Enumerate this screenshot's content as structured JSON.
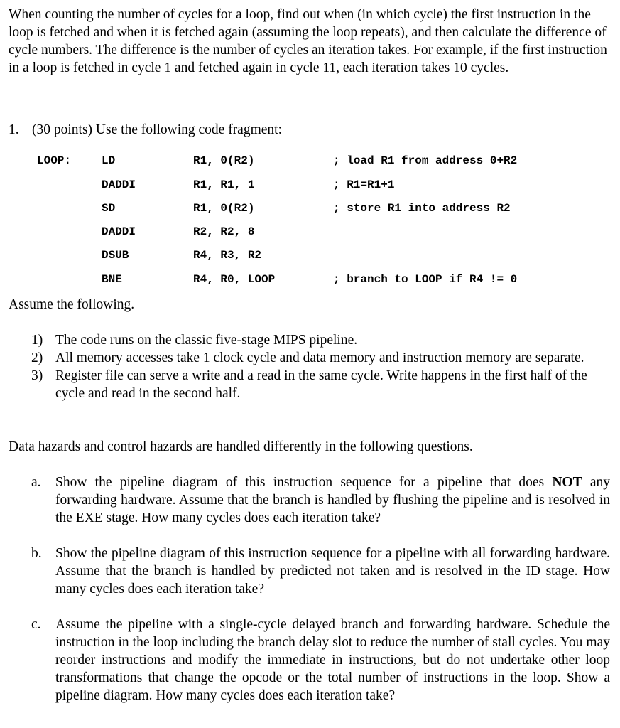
{
  "intro": "When counting the number of cycles for a loop, find out when (in which cycle) the first instruction in the loop is fetched and when it is fetched again (assuming the loop repeats), and then calculate the difference of cycle numbers. The difference is the number of cycles an iteration takes. For example, if the first instruction in a loop is fetched in cycle 1 and fetched again in cycle 11, each iteration takes 10 cycles.",
  "question": {
    "number": "1.",
    "text": "(30 points) Use the following code fragment:"
  },
  "code": [
    {
      "label": "LOOP:",
      "op": "LD",
      "args": "R1, 0(R2)",
      "comment": "; load R1 from address 0+R2"
    },
    {
      "label": "",
      "op": "DADDI",
      "args": "R1, R1, 1",
      "comment": "; R1=R1+1"
    },
    {
      "label": "",
      "op": "SD",
      "args": "R1, 0(R2)",
      "comment": "; store R1 into address R2"
    },
    {
      "label": "",
      "op": "DADDI",
      "args": "R2, R2, 8",
      "comment": ""
    },
    {
      "label": "",
      "op": "DSUB",
      "args": "R4, R3, R2",
      "comment": ""
    },
    {
      "label": "",
      "op": "BNE",
      "args": "R4, R0, LOOP",
      "comment": "; branch to LOOP if R4 != 0"
    }
  ],
  "assume_heading": "Assume the following.",
  "assumptions": [
    {
      "n": "1)",
      "text": "The code runs on the classic five-stage MIPS pipeline."
    },
    {
      "n": "2)",
      "text": "All memory accesses take 1 clock cycle and data memory and instruction memory are separate."
    },
    {
      "n": "3)",
      "text": "Register file can serve a write and a read in the same cycle. Write happens in the first half of the cycle and read in the second half."
    }
  ],
  "hazards_note": "Data hazards and control hazards are handled differently in the following questions.",
  "parts": {
    "a": {
      "label": "a.",
      "pre": "Show the pipeline diagram of this instruction sequence for a pipeline that does ",
      "bold": "NOT",
      "post": " any forwarding hardware. Assume that the branch is handled by flushing the pipeline and is resolved in the EXE stage. How many cycles does each iteration take?"
    },
    "b": {
      "label": "b.",
      "text": "Show the pipeline diagram of this instruction sequence for a pipeline with all forwarding hardware. Assume that the branch is handled by predicted not taken and is resolved in the ID stage. How many cycles does each iteration take?"
    },
    "c": {
      "label": "c.",
      "text": "Assume the pipeline with a single-cycle delayed branch and forwarding hardware. Schedule the instruction in the loop including the branch delay slot to reduce the number of stall cycles. You may reorder instructions and modify the immediate in instructions, but do not undertake other loop transformations that change the opcode or the total number of instructions in the loop. Show a pipeline diagram. How many cycles does each iteration take?"
    }
  }
}
